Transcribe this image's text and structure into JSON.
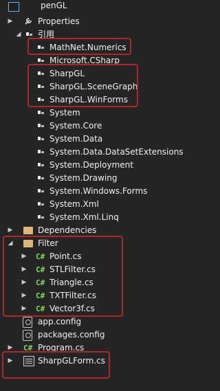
{
  "project": {
    "name": "penGL"
  },
  "nodes": {
    "properties": "Properties",
    "references": "引用",
    "refs": [
      "MathNet.Numerics",
      "Microsoft.CSharp",
      "SharpGL",
      "SharpGL.SceneGraph",
      "SharpGL.WinForms",
      "System",
      "System.Core",
      "System.Data",
      "System.Data.DataSetExtensions",
      "System.Deployment",
      "System.Drawing",
      "System.Windows.Forms",
      "System.Xml",
      "System.Xml.Linq"
    ],
    "dependencies": "Dependencies",
    "filter_folder": "Filter",
    "filter_files": [
      "Point.cs",
      "STLFilter.cs",
      "Triangle.cs",
      "TXTFilter.cs",
      "Vector3f.cs"
    ],
    "app_config": "app.config",
    "packages_config": "packages.config",
    "program": "Program.cs",
    "sharpgl_form": "SharpGLForm.cs"
  },
  "icons": {
    "reference": "reference-icon",
    "csharp": "csharp-file-icon",
    "folder": "folder-icon",
    "form": "winform-icon",
    "config": "config-file-icon"
  },
  "colors": {
    "background": "#252526",
    "highlight": "#b3262c",
    "csharp": "#7ed957"
  }
}
